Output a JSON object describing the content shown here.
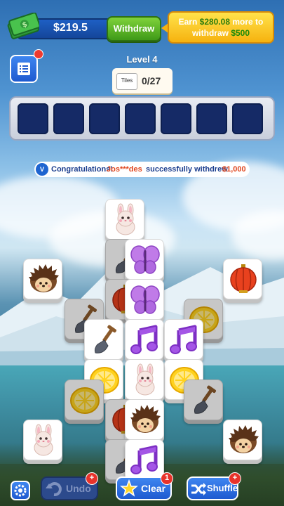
{
  "header": {
    "cash_amount": "$219.5",
    "withdraw_label": "Withdraw",
    "earn_prefix": "Earn",
    "earn_amount": "$280.08",
    "earn_middle": "more to",
    "earn_suffix": "withdraw",
    "earn_target": "$500"
  },
  "level": {
    "title": "Level 4",
    "tiles_chip": "Tiles",
    "progress": "0/27"
  },
  "notice": {
    "text_a": "Congratulations!",
    "user": "Jos***des",
    "text_b": "successfully withdrew",
    "amount": "$1,000"
  },
  "toolbar": {
    "undo_label": "Undo",
    "clear_label": "Clear",
    "clear_count": "1",
    "shuffle_label": "Shuffle"
  },
  "tiles": [
    "bunny",
    "shovel",
    "butterfly",
    "hedgehog",
    "lantern",
    "lantern",
    "butterfly",
    "lemon",
    "shovel",
    "shovel",
    "music-note",
    "music-note",
    "lemon",
    "lemon",
    "bunny",
    "lemon",
    "shovel",
    "lemon",
    "hedgehog",
    "bunny",
    "lantern",
    "hedgehog",
    "shovel",
    "music-note"
  ],
  "colors": {
    "accent_blue": "#1e5ad0",
    "withdraw_green": "#3f9a18",
    "earn_yellow": "#f6b20f",
    "tray_slot": "#152a66"
  }
}
